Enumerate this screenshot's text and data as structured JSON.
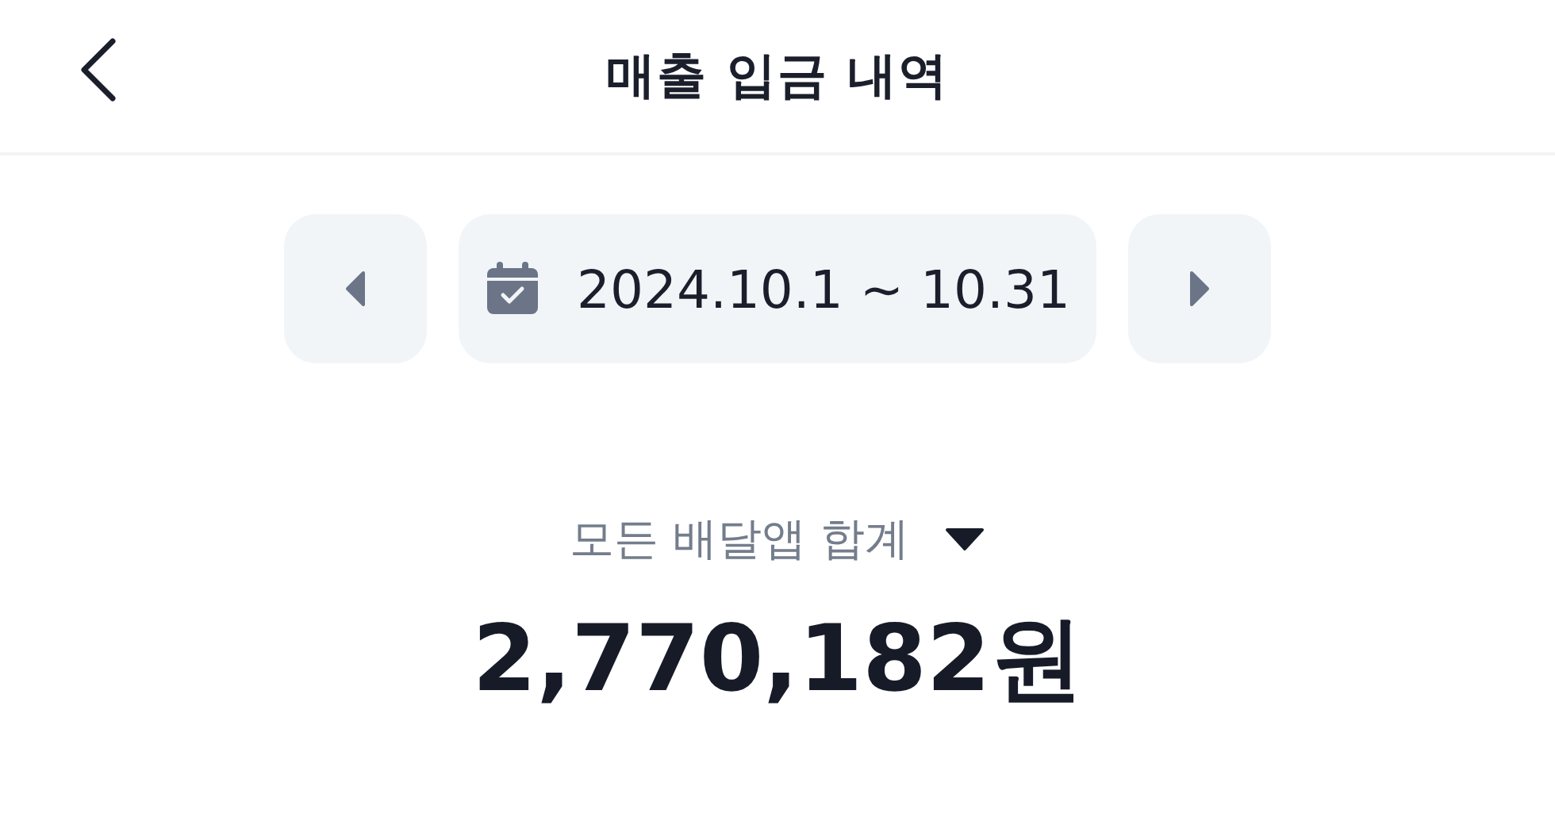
{
  "header": {
    "title": "매출 입금 내역"
  },
  "period": {
    "range": "2024.10.1 ~ 10.31"
  },
  "summary": {
    "filter": "모든 배달앱 합계",
    "total": "2,770,182원"
  }
}
